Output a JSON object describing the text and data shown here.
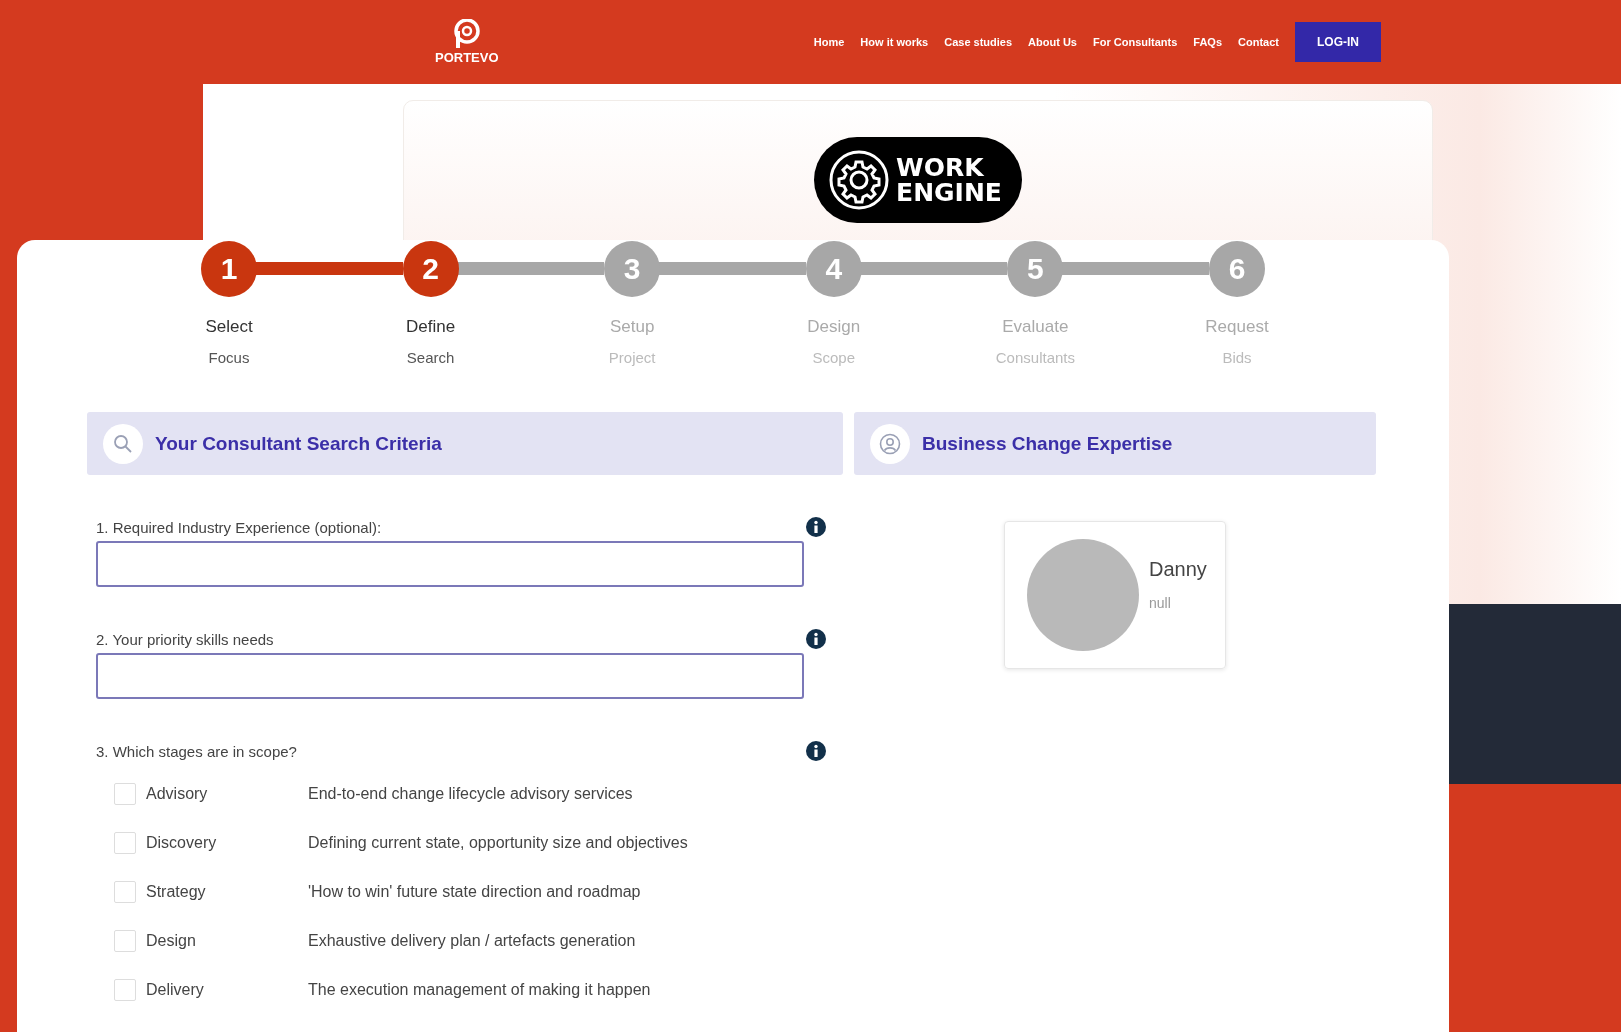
{
  "header": {
    "logo": "PORTEVO",
    "nav": [
      "Home",
      "How it works",
      "Case studies",
      "About Us",
      "For Consultants",
      "FAQs",
      "Contact"
    ],
    "login": "LOG-IN"
  },
  "hero": {
    "badge_lines": [
      "WORK",
      "ENGINE"
    ]
  },
  "steps": [
    {
      "number": "1",
      "title": "Select",
      "subtitle": "Focus",
      "done": true
    },
    {
      "number": "2",
      "title": "Define",
      "subtitle": "Search",
      "done": true
    },
    {
      "number": "3",
      "title": "Setup",
      "subtitle": "Project",
      "done": false
    },
    {
      "number": "4",
      "title": "Design",
      "subtitle": "Scope",
      "done": false
    },
    {
      "number": "5",
      "title": "Evaluate",
      "subtitle": "Consultants",
      "done": false
    },
    {
      "number": "6",
      "title": "Request",
      "subtitle": "Bids",
      "done": false
    }
  ],
  "criteria": {
    "title": "Your Consultant Search Criteria",
    "questions": [
      {
        "label": "1. Required Industry Experience (optional):",
        "kind": "text"
      },
      {
        "label": "2. Your priority skills needs",
        "kind": "text"
      },
      {
        "label": "3. Which stages are in scope?",
        "kind": "checklist"
      }
    ],
    "stages": [
      {
        "name": "Advisory",
        "description": "End-to-end change lifecycle advisory services",
        "checked": false
      },
      {
        "name": "Discovery",
        "description": "Defining current state, opportunity size and objectives",
        "checked": false
      },
      {
        "name": "Strategy",
        "description": "'How to win' future state direction and roadmap",
        "checked": false
      },
      {
        "name": "Design",
        "description": "Exhaustive delivery plan / artefacts generation",
        "checked": false
      },
      {
        "name": "Delivery",
        "description": "The execution management of making it happen",
        "checked": false
      }
    ]
  },
  "expertise": {
    "title": "Business Change Expertise",
    "profile": {
      "name": "Danny",
      "detail": "null"
    }
  }
}
